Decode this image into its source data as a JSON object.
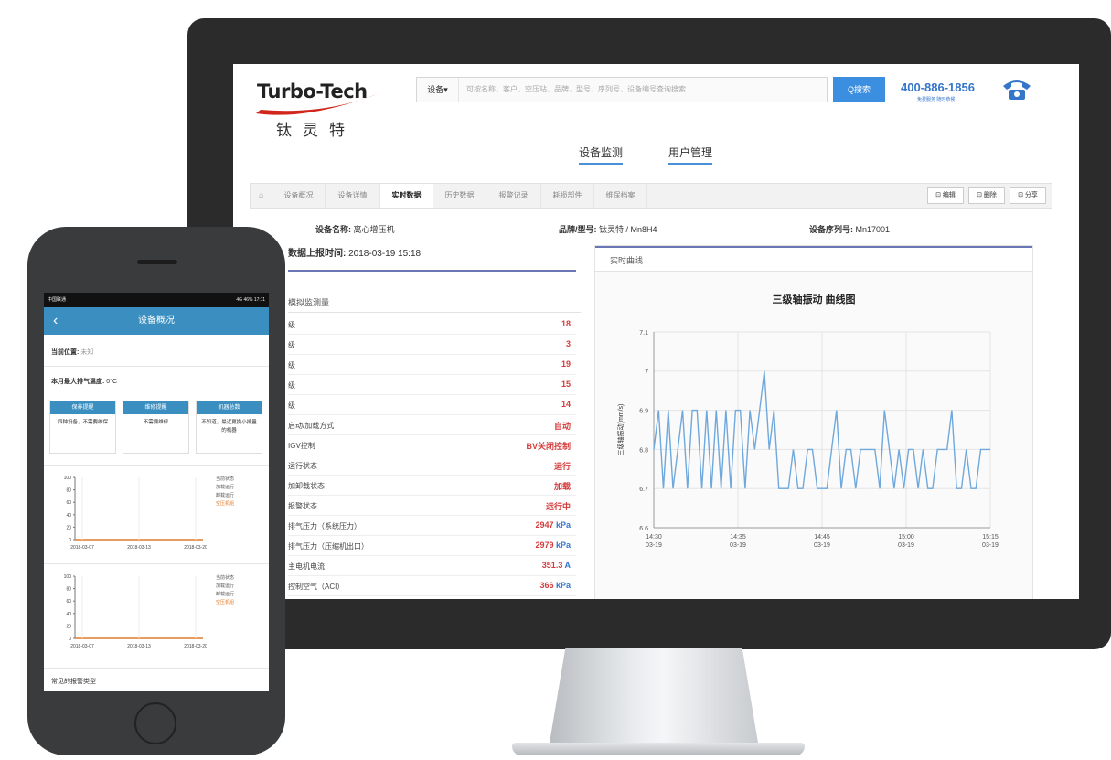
{
  "brand": {
    "logo_text": "Turbo-Tech",
    "logo_cn": "钛灵特"
  },
  "search": {
    "dropdown": "设备▾",
    "placeholder": "可按名称、客户、空压站、品牌、型号、序列号、设备编号查询搜索",
    "button": "Q搜索"
  },
  "hotline": {
    "number": "400-886-1856",
    "sub": "免费服务 随时恭候"
  },
  "topnav": [
    {
      "label": "设备监测"
    },
    {
      "label": "用户管理"
    }
  ],
  "tabs": [
    {
      "label": "⌂"
    },
    {
      "label": "设备概况"
    },
    {
      "label": "设备详情"
    },
    {
      "label": "实时数据"
    },
    {
      "label": "历史数据"
    },
    {
      "label": "报警记录"
    },
    {
      "label": "耗损部件"
    },
    {
      "label": "维保档案"
    }
  ],
  "tab_buttons": [
    {
      "label": "⊡ 编辑"
    },
    {
      "label": "⊡ 删除"
    },
    {
      "label": "⊡ 分享"
    }
  ],
  "device": {
    "name_key": "设备名称:",
    "name_val": "离心增压机",
    "brand_key": "品牌/型号:",
    "brand_val": "钛灵特 / Mn8H4",
    "serial_key": "设备序列号:",
    "serial_val": "Mn17001"
  },
  "upload": {
    "key": "数据上报时间:",
    "val": "2018-03-19 15:18"
  },
  "left_panel": {
    "title": "模拟监测量",
    "rows": [
      {
        "label": "级",
        "value": "18",
        "unit": ""
      },
      {
        "label": "级",
        "value": "3",
        "unit": ""
      },
      {
        "label": "级",
        "value": "19",
        "unit": ""
      },
      {
        "label": "级",
        "value": "15",
        "unit": ""
      },
      {
        "label": "级",
        "value": "14",
        "unit": ""
      },
      {
        "label": "启动/加载方式",
        "value": "自动",
        "unit": ""
      },
      {
        "label": "IGV控制",
        "value": "BV关闭控制",
        "unit": ""
      },
      {
        "label": "运行状态",
        "value": "运行",
        "unit": ""
      },
      {
        "label": "加卸载状态",
        "value": "加载",
        "unit": ""
      },
      {
        "label": "报警状态",
        "value": "运行中",
        "unit": ""
      },
      {
        "label": "排气压力（系统压力）",
        "value": "2947",
        "unit": " kPa"
      },
      {
        "label": "排气压力（压缩机出口）",
        "value": "2979",
        "unit": " kPa"
      },
      {
        "label": "主电机电流",
        "value": "351.3",
        "unit": " A"
      },
      {
        "label": "控制空气（ACI）",
        "value": "366",
        "unit": " kPa"
      }
    ]
  },
  "right_panel": {
    "title": "实时曲线"
  },
  "chart_data": {
    "type": "line",
    "title": "三级轴振动 曲线图",
    "ylabel": "三级轴振动(mm/s)",
    "ylim": [
      6.6,
      7.1
    ],
    "yticks": [
      "6.6",
      "6.7",
      "6.8",
      "6.9",
      "7",
      "7.1"
    ],
    "xticks": [
      {
        "time": "14:30",
        "date": "03-19"
      },
      {
        "time": "14:35",
        "date": "03-19"
      },
      {
        "time": "14:45",
        "date": "03-19"
      },
      {
        "time": "15:00",
        "date": "03-19"
      },
      {
        "time": "15:15",
        "date": "03-19"
      }
    ],
    "series": [
      {
        "color": "#6fa8dc",
        "values": [
          6.8,
          6.9,
          6.7,
          6.9,
          6.7,
          6.8,
          6.9,
          6.7,
          6.9,
          6.9,
          6.7,
          6.9,
          6.7,
          6.9,
          6.7,
          6.9,
          6.7,
          6.9,
          6.9,
          6.7,
          6.9,
          6.8,
          6.9,
          7.0,
          6.8,
          6.9,
          6.7,
          6.7,
          6.7,
          6.8,
          6.7,
          6.7,
          6.8,
          6.8,
          6.7,
          6.7,
          6.7,
          6.8,
          6.9,
          6.7,
          6.8,
          6.8,
          6.7,
          6.8,
          6.8,
          6.8,
          6.8,
          6.7,
          6.9,
          6.8,
          6.7,
          6.8,
          6.7,
          6.8,
          6.8,
          6.7,
          6.8,
          6.7,
          6.7,
          6.8,
          6.8,
          6.8,
          6.9,
          6.7,
          6.7,
          6.8,
          6.7,
          6.7,
          6.8,
          6.8,
          6.8
        ]
      }
    ]
  },
  "mobile": {
    "status_left": "中国联通",
    "status_right": "4G 46% 17:11",
    "title": "设备概况",
    "location_key": "当前位置:",
    "location_val": "未知",
    "temp_key": "本月最大排气温度:",
    "temp_val": "0°C",
    "cards": [
      {
        "head": "保养提醒",
        "body": "四种设备，不需要维保"
      },
      {
        "head": "维修提醒",
        "body": "不需要维修"
      },
      {
        "head": "机器总数",
        "body": "不知道，最近更换小排量的机器"
      }
    ],
    "legend1": [
      "当前状态",
      "加载运行",
      "卸载运行",
      "空压机组"
    ],
    "legend2": [
      "当前状态",
      "加载运行",
      "卸载运行",
      "空压机组"
    ],
    "chart_y": [
      "100",
      "80",
      "60",
      "40",
      "20",
      "0"
    ],
    "chart_x": [
      "2018-03-07",
      "2018-03-13",
      "2018-03-20"
    ],
    "footer": "常见的报警类型"
  }
}
